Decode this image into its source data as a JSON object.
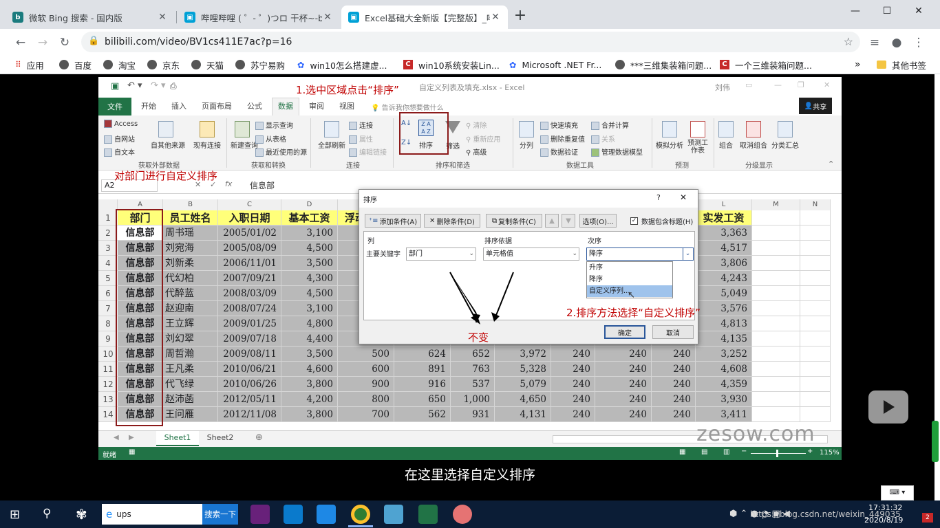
{
  "browser": {
    "tabs": [
      {
        "title": "微软 Bing 搜索 - 国内版",
        "icon": "bing-icon",
        "color": "#1a7b7e"
      },
      {
        "title": "哔哩哔哩 ( ゜- ゜)つロ 干杯~-bilil",
        "icon": "bilibili-icon",
        "color": "#00a1d6"
      },
      {
        "title": "Excel基础大全新版【完整版】_哔",
        "icon": "bilibili-icon",
        "color": "#00a1d6"
      }
    ],
    "new_tab": "+",
    "url": "bilibili.com/video/BV1cs411E7ac?p=16",
    "bookmarks": [
      "应用",
      "百度",
      "淘宝",
      "京东",
      "天猫",
      "苏宁易购",
      "win10怎么搭建虚...",
      "win10系统安装Lin...",
      "Microsoft .NET Fr...",
      "***三维集装箱问题...",
      "一个三维装箱问题..."
    ],
    "bookmarks_more": "»",
    "bookmarks_other": "其他书签"
  },
  "excel": {
    "qat_title": "自定义列表及填充.xlsx - Excel",
    "user": "刘伟",
    "ribbon_tabs": [
      "文件",
      "开始",
      "插入",
      "页面布局",
      "公式",
      "数据",
      "审阅",
      "视图"
    ],
    "tell_me": "告诉我你想要做什么",
    "share": "共享",
    "ribbon": {
      "get_external": {
        "items": [
          "Access",
          "自网站",
          "自文本",
          "自其他来源",
          "现有连接"
        ],
        "label": "获取外部数据"
      },
      "get_transform": {
        "items": [
          "新建查询",
          "显示查询",
          "从表格",
          "最近使用的源"
        ],
        "label": "获取和转换"
      },
      "connections": {
        "items": [
          "全部刷新",
          "连接",
          "属性",
          "编辑链接"
        ],
        "label": "连接"
      },
      "sort_filter": {
        "items": [
          "排序",
          "筛选",
          "清除",
          "重新应用",
          "高级"
        ],
        "label": "排序和筛选"
      },
      "data_tools": {
        "items": [
          "分列",
          "快速填充",
          "删除重复值",
          "数据验证",
          "合并计算",
          "关系",
          "管理数据模型"
        ],
        "label": "数据工具"
      },
      "forecast": {
        "items": [
          "模拟分析",
          "预测工作表"
        ],
        "label": "预测"
      },
      "outline": {
        "items": [
          "组合",
          "取消组合",
          "分类汇总"
        ],
        "label": "分级显示"
      }
    },
    "name_box": "A2",
    "formula": "信息部",
    "columns": [
      "A",
      "B",
      "C",
      "D",
      "E",
      "F",
      "G",
      "H",
      "I",
      "J",
      "K",
      "L",
      "M",
      "N"
    ],
    "headers": [
      "部门",
      "员工姓名",
      "入职日期",
      "基本工资",
      "浮动",
      "",
      "",
      "",
      "",
      "",
      "",
      "实发工资"
    ],
    "rows": [
      {
        "n": "2",
        "dept": "信息部",
        "name": "周书瑶",
        "date": "2005/01/02",
        "base": "3,100",
        "e": "",
        "f": "",
        "g": "",
        "h": "",
        "i": "",
        "j": "",
        "k": "",
        "net": "3,363"
      },
      {
        "n": "3",
        "dept": "信息部",
        "name": "刘宛海",
        "date": "2005/08/09",
        "base": "4,500",
        "e": "",
        "f": "",
        "g": "",
        "h": "",
        "i": "",
        "j": "",
        "k": "",
        "net": "4,517"
      },
      {
        "n": "4",
        "dept": "信息部",
        "name": "刘新柔",
        "date": "2006/11/01",
        "base": "3,500",
        "e": "",
        "f": "",
        "g": "",
        "h": "",
        "i": "",
        "j": "",
        "k": "",
        "net": "3,806"
      },
      {
        "n": "5",
        "dept": "信息部",
        "name": "代幻柏",
        "date": "2007/09/21",
        "base": "4,300",
        "e": "",
        "f": "",
        "g": "",
        "h": "",
        "i": "",
        "j": "",
        "k": "",
        "net": "4,243"
      },
      {
        "n": "6",
        "dept": "信息部",
        "name": "代醉蓝",
        "date": "2008/03/09",
        "base": "4,500",
        "e": "",
        "f": "",
        "g": "",
        "h": "",
        "i": "",
        "j": "",
        "k": "",
        "net": "5,049"
      },
      {
        "n": "7",
        "dept": "信息部",
        "name": "赵迎南",
        "date": "2008/07/24",
        "base": "3,100",
        "e": "",
        "f": "",
        "g": "",
        "h": "",
        "i": "",
        "j": "",
        "k": "",
        "net": "3,576"
      },
      {
        "n": "8",
        "dept": "信息部",
        "name": "王立辉",
        "date": "2009/01/25",
        "base": "4,800",
        "e": "",
        "f": "",
        "g": "",
        "h": "",
        "i": "",
        "j": "",
        "k": "",
        "net": "4,813"
      },
      {
        "n": "9",
        "dept": "信息部",
        "name": "刘幻翠",
        "date": "2009/07/18",
        "base": "4,400",
        "e": "",
        "f": "",
        "g": "",
        "h": "",
        "i": "",
        "j": "",
        "k": "",
        "net": "4,135"
      },
      {
        "n": "10",
        "dept": "信息部",
        "name": "周哲瀚",
        "date": "2009/08/11",
        "base": "3,500",
        "e": "500",
        "f": "624",
        "g": "652",
        "h": "3,972",
        "i": "240",
        "j": "240",
        "k": "240",
        "net": "3,252"
      },
      {
        "n": "11",
        "dept": "信息部",
        "name": "王凡柔",
        "date": "2010/06/21",
        "base": "4,600",
        "e": "600",
        "f": "891",
        "g": "763",
        "h": "5,328",
        "i": "240",
        "j": "240",
        "k": "240",
        "net": "4,608"
      },
      {
        "n": "12",
        "dept": "信息部",
        "name": "代飞绿",
        "date": "2010/06/26",
        "base": "3,800",
        "e": "900",
        "f": "916",
        "g": "537",
        "h": "5,079",
        "i": "240",
        "j": "240",
        "k": "240",
        "net": "4,359"
      },
      {
        "n": "13",
        "dept": "信息部",
        "name": "赵沛菡",
        "date": "2012/05/11",
        "base": "4,200",
        "e": "800",
        "f": "650",
        "g": "1,000",
        "h": "4,650",
        "i": "240",
        "j": "240",
        "k": "240",
        "net": "3,930"
      },
      {
        "n": "14",
        "dept": "信息部",
        "name": "王问雁",
        "date": "2012/11/08",
        "base": "3,800",
        "e": "700",
        "f": "562",
        "g": "931",
        "h": "4,131",
        "i": "240",
        "j": "240",
        "k": "240",
        "net": "3,411"
      }
    ],
    "sheets": [
      "Sheet1",
      "Sheet2"
    ],
    "status_ready": "就绪",
    "zoom": "115%"
  },
  "dialog": {
    "title": "排序",
    "help": "?",
    "close": "✕",
    "add_level": "添加条件(A)",
    "delete_level": "删除条件(D)",
    "copy_level": "复制条件(C)",
    "options": "选项(O)...",
    "has_headers": "数据包含标题(H)",
    "col_header": "列",
    "sort_on_header": "排序依据",
    "order_header": "次序",
    "sort_by_label": "主要关键字",
    "sort_by_value": "部门",
    "sort_on_value": "单元格值",
    "order_value": "降序",
    "order_options": [
      "升序",
      "降序",
      "自定义序列..."
    ],
    "ok": "确定",
    "cancel": "取消"
  },
  "annotations": {
    "step1": "1.选中区域点击“排序”",
    "dept_note": "对部门进行自定义排序",
    "step2": "2.排序方法选择“自定义排序”",
    "unchanged": "不变"
  },
  "subtitle": "在这里选择自定义排序",
  "watermark": "zesow.com",
  "taskbar": {
    "search_text": "ups",
    "search_button": "搜索一下",
    "tray_url": "https://blog.csdn.net/weixin_449035",
    "time": "17:31:32",
    "date": "2020/8/19",
    "badge": "2"
  },
  "colors": {
    "excel_green": "#217346",
    "annotation_red": "#c00000",
    "header_yellow": "#ffff7a",
    "highlight_blue": "#9fc3ec"
  }
}
